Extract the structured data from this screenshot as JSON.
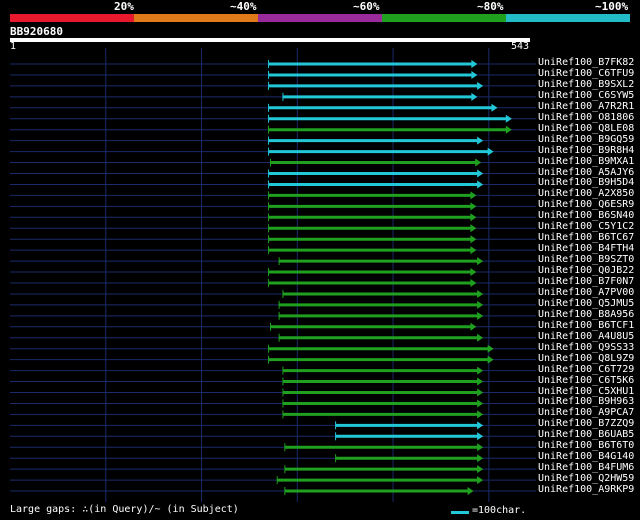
{
  "legend": {
    "segments": [
      {
        "label": "20%",
        "color": "#e8192c"
      },
      {
        "label": "~40%",
        "color": "#e07b1c"
      },
      {
        "label": "~60%",
        "color": "#9b2b9b"
      },
      {
        "label": "~80%",
        "color": "#1fa01f"
      },
      {
        "label": "~100%",
        "color": "#22bcc8"
      }
    ]
  },
  "query": {
    "name": "BB920680",
    "start_label": "1",
    "end_label": "543",
    "length": 543
  },
  "hits": [
    {
      "name": "UniRef100_B7FK82",
      "start": 270,
      "end": 487,
      "color": "cyan"
    },
    {
      "name": "UniRef100_C6TFU9",
      "start": 270,
      "end": 487,
      "color": "cyan"
    },
    {
      "name": "UniRef100_B9SXL2",
      "start": 270,
      "end": 493,
      "color": "cyan"
    },
    {
      "name": "UniRef100_C6SYW5",
      "start": 285,
      "end": 487,
      "color": "cyan"
    },
    {
      "name": "UniRef100_A7R2R1",
      "start": 270,
      "end": 508,
      "color": "cyan"
    },
    {
      "name": "UniRef100_O81806",
      "start": 270,
      "end": 523,
      "color": "cyan"
    },
    {
      "name": "UniRef100_Q8LE08",
      "start": 270,
      "end": 523,
      "color": "green"
    },
    {
      "name": "UniRef100_B9GQ59",
      "start": 270,
      "end": 493,
      "color": "cyan"
    },
    {
      "name": "UniRef100_B9R8H4",
      "start": 270,
      "end": 504,
      "color": "cyan"
    },
    {
      "name": "UniRef100_B9MXA1",
      "start": 272,
      "end": 491,
      "color": "green"
    },
    {
      "name": "UniRef100_A5AJY6",
      "start": 270,
      "end": 493,
      "color": "cyan"
    },
    {
      "name": "UniRef100_B9H5D4",
      "start": 270,
      "end": 493,
      "color": "cyan"
    },
    {
      "name": "UniRef100_A2X850",
      "start": 270,
      "end": 486,
      "color": "green"
    },
    {
      "name": "UniRef100_Q6ESR9",
      "start": 270,
      "end": 486,
      "color": "green"
    },
    {
      "name": "UniRef100_B6SN40",
      "start": 270,
      "end": 486,
      "color": "green"
    },
    {
      "name": "UniRef100_C5Y1C2",
      "start": 270,
      "end": 486,
      "color": "green"
    },
    {
      "name": "UniRef100_B6TC67",
      "start": 270,
      "end": 486,
      "color": "green"
    },
    {
      "name": "UniRef100_B4FTH4",
      "start": 270,
      "end": 486,
      "color": "green"
    },
    {
      "name": "UniRef100_B9SZT0",
      "start": 281,
      "end": 493,
      "color": "green"
    },
    {
      "name": "UniRef100_Q0JB22",
      "start": 270,
      "end": 486,
      "color": "green"
    },
    {
      "name": "UniRef100_B7F0N7",
      "start": 270,
      "end": 486,
      "color": "green"
    },
    {
      "name": "UniRef100_A7PV00",
      "start": 285,
      "end": 493,
      "color": "green"
    },
    {
      "name": "UniRef100_Q5JMU5",
      "start": 281,
      "end": 493,
      "color": "green"
    },
    {
      "name": "UniRef100_B8A956",
      "start": 281,
      "end": 493,
      "color": "green"
    },
    {
      "name": "UniRef100_B6TCF1",
      "start": 272,
      "end": 486,
      "color": "green"
    },
    {
      "name": "UniRef100_A4U8U5",
      "start": 281,
      "end": 493,
      "color": "green"
    },
    {
      "name": "UniRef100_Q9SS33",
      "start": 270,
      "end": 504,
      "color": "green"
    },
    {
      "name": "UniRef100_Q8L9Z9",
      "start": 270,
      "end": 504,
      "color": "green"
    },
    {
      "name": "UniRef100_C6T729",
      "start": 285,
      "end": 493,
      "color": "green"
    },
    {
      "name": "UniRef100_C6T5K6",
      "start": 285,
      "end": 493,
      "color": "green"
    },
    {
      "name": "UniRef100_C5XHU1",
      "start": 285,
      "end": 493,
      "color": "green"
    },
    {
      "name": "UniRef100_B9H963",
      "start": 285,
      "end": 493,
      "color": "green"
    },
    {
      "name": "UniRef100_A9PCA7",
      "start": 285,
      "end": 493,
      "color": "green"
    },
    {
      "name": "UniRef100_B7ZZQ9",
      "start": 340,
      "end": 493,
      "color": "cyan"
    },
    {
      "name": "UniRef100_B6UAB5",
      "start": 340,
      "end": 493,
      "color": "cyan"
    },
    {
      "name": "UniRef100_B6T6T0",
      "start": 287,
      "end": 493,
      "color": "green"
    },
    {
      "name": "UniRef100_B4G140",
      "start": 340,
      "end": 493,
      "color": "green"
    },
    {
      "name": "UniRef100_B4FUM6",
      "start": 287,
      "end": 493,
      "color": "green"
    },
    {
      "name": "UniRef100_Q2HW59",
      "start": 279,
      "end": 493,
      "color": "green"
    },
    {
      "name": "UniRef100_A9RKP9",
      "start": 287,
      "end": 483,
      "color": "green"
    }
  ],
  "colors": {
    "cyan": "#22c8d8",
    "green": "#1fa01f",
    "grid": "#1a2a6a",
    "bg": "#000000"
  },
  "footer": {
    "left_text": "Large gaps: ∴(in Query)/~ (in Subject)",
    "scale_text": "=100char."
  }
}
